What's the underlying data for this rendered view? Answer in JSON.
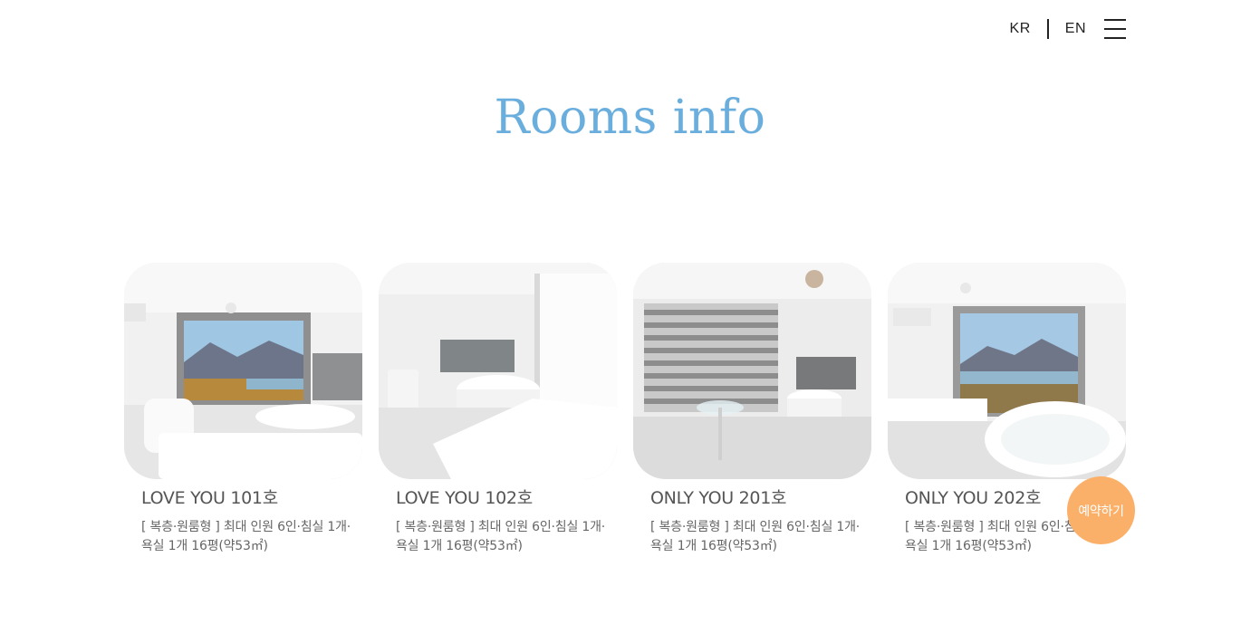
{
  "header": {
    "lang_kr": "KR",
    "lang_en": "EN"
  },
  "page_title": "Rooms info",
  "rooms": [
    {
      "name": "LOVE YOU 101호",
      "desc": "[ 복층·원룸형 ] 최대 인원 6인·침실 1개·욕실 1개 16평(약53㎡)"
    },
    {
      "name": "LOVE YOU 102호",
      "desc": "[ 복층·원룸형 ] 최대 인원 6인·침실 1개·욕실 1개 16평(약53㎡)"
    },
    {
      "name": "ONLY YOU 201호",
      "desc": "[ 복층·원룸형 ] 최대 인원 6인·침실 1개·욕실 1개 16평(약53㎡)"
    },
    {
      "name": "ONLY YOU 202호",
      "desc": "[ 복층·원룸형 ] 최대 인원 6인·침실 1개·욕실 1개 16평(약53㎡)"
    }
  ],
  "reserve_button": "예약하기",
  "colors": {
    "title": "#6aaedd",
    "reserve": "#fbb06a"
  },
  "icons": [
    "menu-icon"
  ]
}
